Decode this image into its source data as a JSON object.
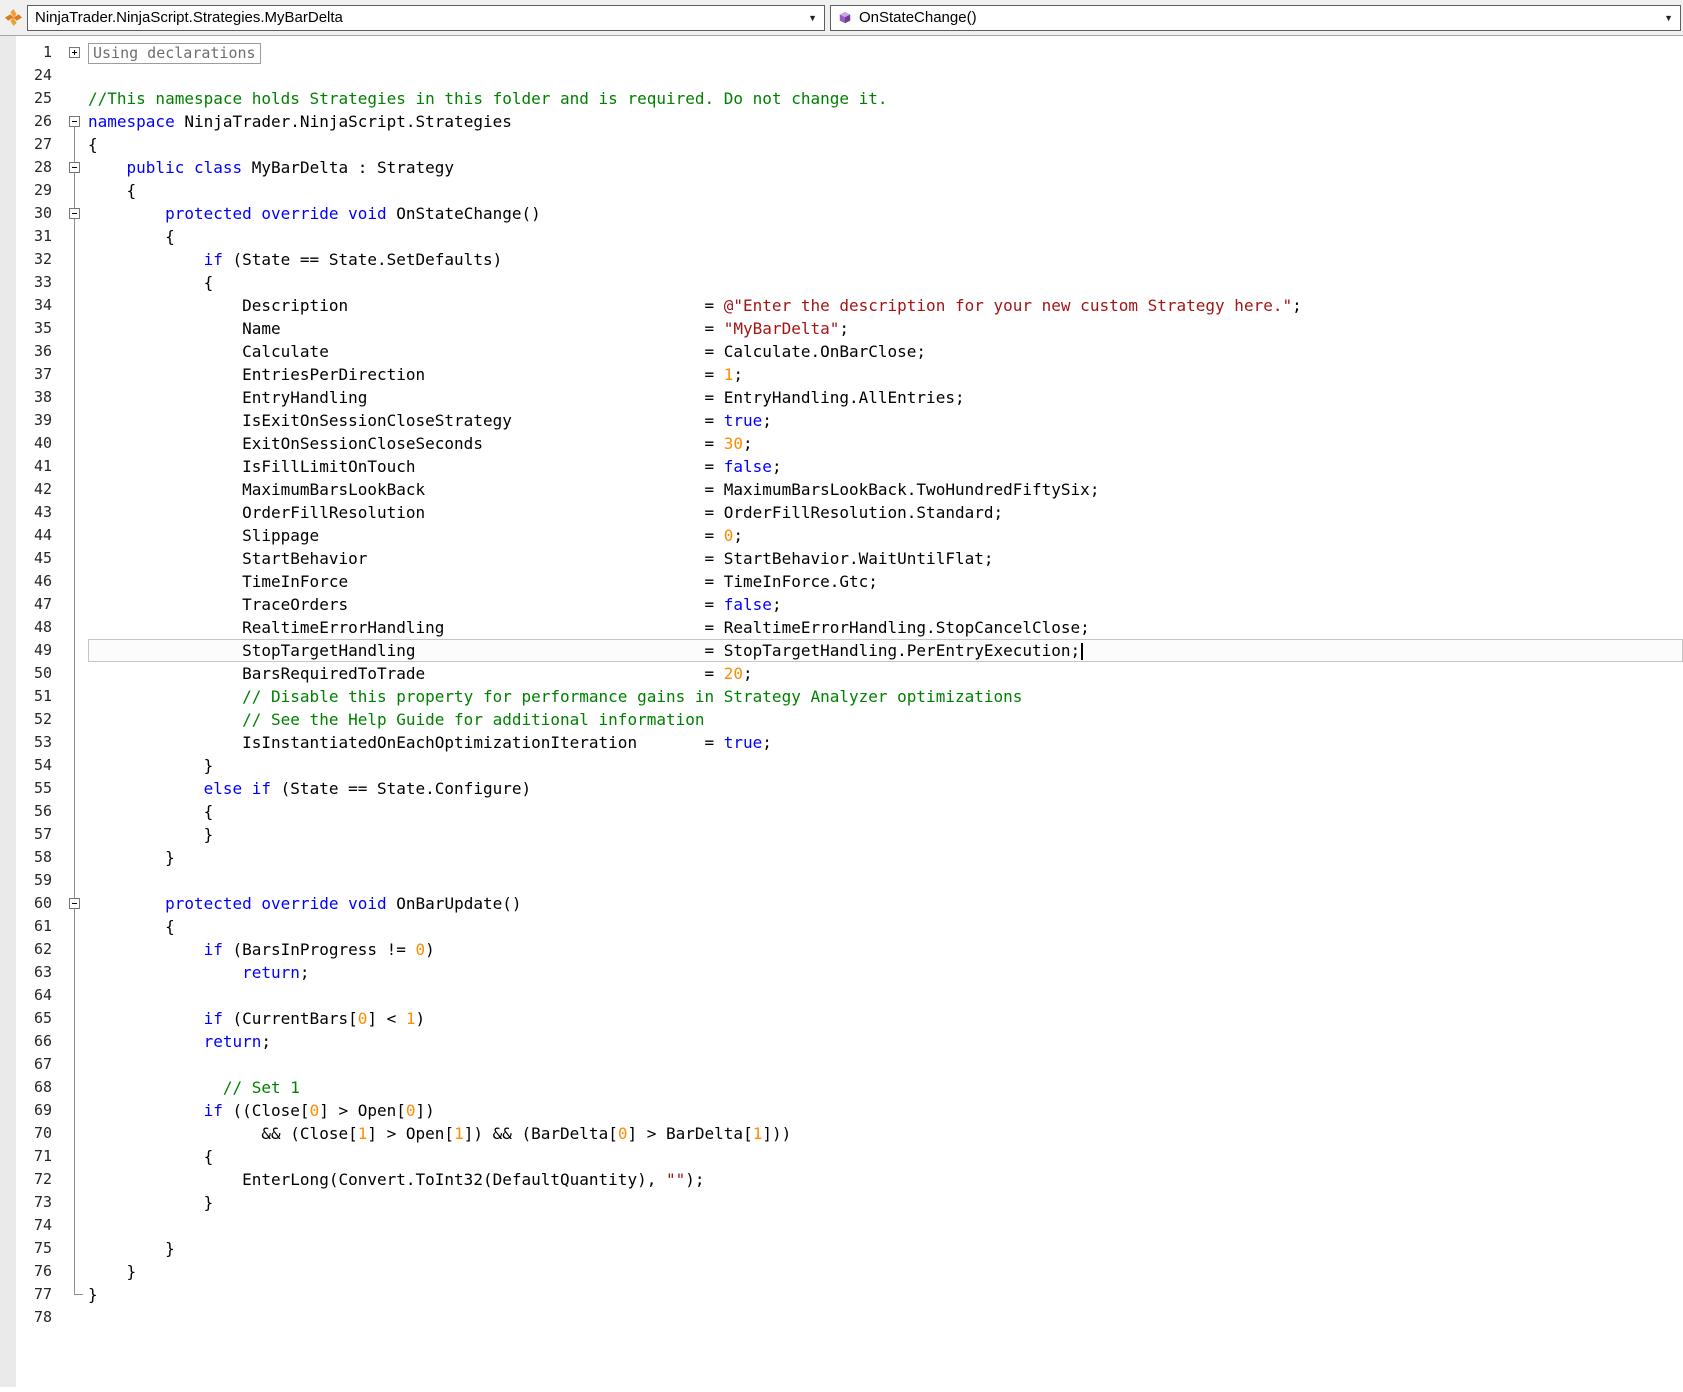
{
  "colors": {
    "keyword": "#0000ff",
    "comment": "#008000",
    "string": "#a31515",
    "number": "#ff8c00",
    "ninjatrader_icon_orange": "#e8862a",
    "method_icon_purple": "#8a56a8",
    "current_line_border": "#c6c6c6"
  },
  "nav": {
    "type_dropdown": "NinjaTrader.NinjaScript.Strategies.MyBarDelta",
    "member_dropdown": "OnStateChange()"
  },
  "editor": {
    "collapsed_region_label": "Using declarations",
    "lines": [
      {
        "n": 1,
        "f": "p",
        "region": "Using declarations"
      },
      {
        "n": 24
      },
      {
        "n": 25,
        "i": 0,
        "t": [
          [
            "c",
            "//This namespace holds Strategies in this folder and is required. Do not change it."
          ]
        ]
      },
      {
        "n": 26,
        "f": "m0",
        "i": 0,
        "t": [
          [
            "k",
            "namespace"
          ],
          [
            "p",
            " NinjaTrader.NinjaScript.Strategies"
          ]
        ]
      },
      {
        "n": 27,
        "f": "v",
        "i": 0,
        "t": [
          [
            "p",
            "{"
          ]
        ]
      },
      {
        "n": 28,
        "f": "m",
        "i": 4,
        "t": [
          [
            "k",
            "public"
          ],
          [
            "p",
            " "
          ],
          [
            "k",
            "class"
          ],
          [
            "p",
            " MyBarDelta : Strategy"
          ]
        ]
      },
      {
        "n": 29,
        "f": "v",
        "i": 4,
        "t": [
          [
            "p",
            "{"
          ]
        ]
      },
      {
        "n": 30,
        "f": "m",
        "i": 8,
        "t": [
          [
            "k",
            "protected"
          ],
          [
            "p",
            " "
          ],
          [
            "k",
            "override"
          ],
          [
            "p",
            " "
          ],
          [
            "k",
            "void"
          ],
          [
            "p",
            " OnStateChange()"
          ]
        ]
      },
      {
        "n": 31,
        "f": "v",
        "i": 8,
        "t": [
          [
            "p",
            "{"
          ]
        ]
      },
      {
        "n": 32,
        "f": "v",
        "i": 12,
        "t": [
          [
            "k",
            "if"
          ],
          [
            "p",
            " (State == State.SetDefaults)"
          ]
        ]
      },
      {
        "n": 33,
        "f": "v",
        "i": 12,
        "t": [
          [
            "p",
            "{"
          ]
        ]
      },
      {
        "n": 34,
        "f": "v",
        "prop": "Description",
        "t": [
          [
            "p",
            "= "
          ],
          [
            "s",
            "@\"Enter the description for your new custom Strategy here.\""
          ],
          [
            "p",
            ";"
          ]
        ]
      },
      {
        "n": 35,
        "f": "v",
        "prop": "Name",
        "t": [
          [
            "p",
            "= "
          ],
          [
            "s",
            "\"MyBarDelta\""
          ],
          [
            "p",
            ";"
          ]
        ]
      },
      {
        "n": 36,
        "f": "v",
        "prop": "Calculate",
        "t": [
          [
            "p",
            "= Calculate.OnBarClose;"
          ]
        ]
      },
      {
        "n": 37,
        "f": "v",
        "prop": "EntriesPerDirection",
        "t": [
          [
            "p",
            "= "
          ],
          [
            "n",
            "1"
          ],
          [
            "p",
            ";"
          ]
        ]
      },
      {
        "n": 38,
        "f": "v",
        "prop": "EntryHandling",
        "t": [
          [
            "p",
            "= EntryHandling.AllEntries;"
          ]
        ]
      },
      {
        "n": 39,
        "f": "v",
        "prop": "IsExitOnSessionCloseStrategy",
        "t": [
          [
            "p",
            "= "
          ],
          [
            "k",
            "true"
          ],
          [
            "p",
            ";"
          ]
        ]
      },
      {
        "n": 40,
        "f": "v",
        "prop": "ExitOnSessionCloseSeconds",
        "t": [
          [
            "p",
            "= "
          ],
          [
            "n",
            "30"
          ],
          [
            "p",
            ";"
          ]
        ]
      },
      {
        "n": 41,
        "f": "v",
        "prop": "IsFillLimitOnTouch",
        "t": [
          [
            "p",
            "= "
          ],
          [
            "k",
            "false"
          ],
          [
            "p",
            ";"
          ]
        ]
      },
      {
        "n": 42,
        "f": "v",
        "prop": "MaximumBarsLookBack",
        "t": [
          [
            "p",
            "= MaximumBarsLookBack.TwoHundredFiftySix;"
          ]
        ]
      },
      {
        "n": 43,
        "f": "v",
        "prop": "OrderFillResolution",
        "t": [
          [
            "p",
            "= OrderFillResolution.Standard;"
          ]
        ]
      },
      {
        "n": 44,
        "f": "v",
        "prop": "Slippage",
        "t": [
          [
            "p",
            "= "
          ],
          [
            "n",
            "0"
          ],
          [
            "p",
            ";"
          ]
        ]
      },
      {
        "n": 45,
        "f": "v",
        "prop": "StartBehavior",
        "t": [
          [
            "p",
            "= StartBehavior.WaitUntilFlat;"
          ]
        ]
      },
      {
        "n": 46,
        "f": "v",
        "prop": "TimeInForce",
        "t": [
          [
            "p",
            "= TimeInForce.Gtc;"
          ]
        ]
      },
      {
        "n": 47,
        "f": "v",
        "prop": "TraceOrders",
        "t": [
          [
            "p",
            "= "
          ],
          [
            "k",
            "false"
          ],
          [
            "p",
            ";"
          ]
        ]
      },
      {
        "n": 48,
        "f": "v",
        "prop": "RealtimeErrorHandling",
        "t": [
          [
            "p",
            "= RealtimeErrorHandling.StopCancelClose;"
          ]
        ]
      },
      {
        "n": 49,
        "f": "v",
        "cur": true,
        "caret": true,
        "prop": "StopTargetHandling",
        "t": [
          [
            "p",
            "= StopTargetHandling.PerEntryExecution;"
          ]
        ]
      },
      {
        "n": 50,
        "f": "v",
        "prop": "BarsRequiredToTrade",
        "t": [
          [
            "p",
            "= "
          ],
          [
            "n",
            "20"
          ],
          [
            "p",
            ";"
          ]
        ]
      },
      {
        "n": 51,
        "f": "v",
        "i": 16,
        "t": [
          [
            "c",
            "// Disable this property for performance gains in Strategy Analyzer optimizations"
          ]
        ]
      },
      {
        "n": 52,
        "f": "v",
        "i": 16,
        "t": [
          [
            "c",
            "// See the Help Guide for additional information"
          ]
        ]
      },
      {
        "n": 53,
        "f": "v",
        "prop": "IsInstantiatedOnEachOptimizationIteration",
        "t": [
          [
            "p",
            "= "
          ],
          [
            "k",
            "true"
          ],
          [
            "p",
            ";"
          ]
        ]
      },
      {
        "n": 54,
        "f": "v",
        "i": 12,
        "t": [
          [
            "p",
            "}"
          ]
        ]
      },
      {
        "n": 55,
        "f": "v",
        "i": 12,
        "t": [
          [
            "k",
            "else"
          ],
          [
            "p",
            " "
          ],
          [
            "k",
            "if"
          ],
          [
            "p",
            " (State == State.Configure)"
          ]
        ]
      },
      {
        "n": 56,
        "f": "v",
        "i": 12,
        "t": [
          [
            "p",
            "{"
          ]
        ]
      },
      {
        "n": 57,
        "f": "v",
        "i": 12,
        "t": [
          [
            "p",
            "}"
          ]
        ]
      },
      {
        "n": 58,
        "f": "v",
        "i": 8,
        "t": [
          [
            "p",
            "}"
          ]
        ]
      },
      {
        "n": 59,
        "f": "v"
      },
      {
        "n": 60,
        "f": "m",
        "i": 8,
        "t": [
          [
            "k",
            "protected"
          ],
          [
            "p",
            " "
          ],
          [
            "k",
            "override"
          ],
          [
            "p",
            " "
          ],
          [
            "k",
            "void"
          ],
          [
            "p",
            " OnBarUpdate()"
          ]
        ]
      },
      {
        "n": 61,
        "f": "v",
        "i": 8,
        "t": [
          [
            "p",
            "{"
          ]
        ]
      },
      {
        "n": 62,
        "f": "v",
        "i": 12,
        "t": [
          [
            "k",
            "if"
          ],
          [
            "p",
            " (BarsInProgress != "
          ],
          [
            "n",
            "0"
          ],
          [
            "p",
            ")"
          ]
        ]
      },
      {
        "n": 63,
        "f": "v",
        "i": 16,
        "t": [
          [
            "k",
            "return"
          ],
          [
            "p",
            ";"
          ]
        ]
      },
      {
        "n": 64,
        "f": "v"
      },
      {
        "n": 65,
        "f": "v",
        "i": 12,
        "t": [
          [
            "k",
            "if"
          ],
          [
            "p",
            " (CurrentBars["
          ],
          [
            "n",
            "0"
          ],
          [
            "p",
            "] < "
          ],
          [
            "n",
            "1"
          ],
          [
            "p",
            ")"
          ]
        ]
      },
      {
        "n": 66,
        "f": "v",
        "i": 12,
        "t": [
          [
            "k",
            "return"
          ],
          [
            "p",
            ";"
          ]
        ]
      },
      {
        "n": 67,
        "f": "v"
      },
      {
        "n": 68,
        "f": "v",
        "i": 14,
        "t": [
          [
            "c",
            "// Set 1"
          ]
        ]
      },
      {
        "n": 69,
        "f": "v",
        "i": 12,
        "t": [
          [
            "k",
            "if"
          ],
          [
            "p",
            " ((Close["
          ],
          [
            "n",
            "0"
          ],
          [
            "p",
            "] > Open["
          ],
          [
            "n",
            "0"
          ],
          [
            "p",
            "])"
          ]
        ]
      },
      {
        "n": 70,
        "f": "v",
        "i": 18,
        "t": [
          [
            "p",
            "&& (Close["
          ],
          [
            "n",
            "1"
          ],
          [
            "p",
            "] > Open["
          ],
          [
            "n",
            "1"
          ],
          [
            "p",
            "]) && (BarDelta["
          ],
          [
            "n",
            "0"
          ],
          [
            "p",
            "] > BarDelta["
          ],
          [
            "n",
            "1"
          ],
          [
            "p",
            "]))"
          ]
        ]
      },
      {
        "n": 71,
        "f": "v",
        "i": 12,
        "t": [
          [
            "p",
            "{"
          ]
        ]
      },
      {
        "n": 72,
        "f": "v",
        "i": 16,
        "t": [
          [
            "p",
            "EnterLong(Convert.ToInt32(DefaultQuantity), "
          ],
          [
            "s",
            "\"\""
          ],
          [
            "p",
            ");"
          ]
        ]
      },
      {
        "n": 73,
        "f": "v",
        "i": 12,
        "t": [
          [
            "p",
            "}"
          ]
        ]
      },
      {
        "n": 74,
        "f": "v"
      },
      {
        "n": 75,
        "f": "v",
        "i": 8,
        "t": [
          [
            "p",
            "}"
          ]
        ]
      },
      {
        "n": 76,
        "f": "v",
        "i": 4,
        "t": [
          [
            "p",
            "}"
          ]
        ]
      },
      {
        "n": 77,
        "f": "e",
        "i": 0,
        "t": [
          [
            "p",
            "}"
          ]
        ]
      },
      {
        "n": 78
      }
    ]
  }
}
